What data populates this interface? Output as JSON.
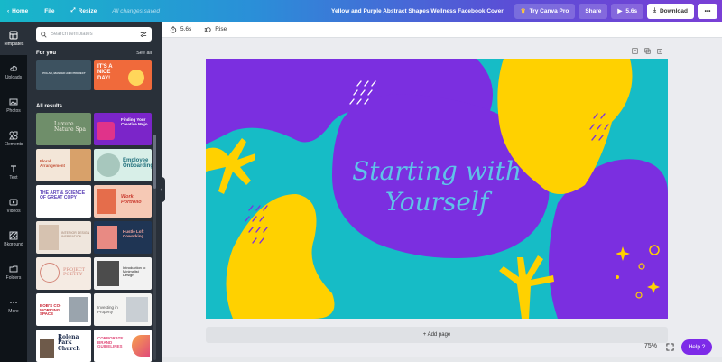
{
  "topbar": {
    "home_label": "Home",
    "file_label": "File",
    "resize_label": "Resize",
    "saved_status": "All changes saved",
    "doc_title": "Yellow and Purple Abstract Shapes Wellness Facebook Cover",
    "pro_label": "Try Canva Pro",
    "share_label": "Share",
    "duration_label": "5.6s",
    "download_label": "Download",
    "more_label": "•••"
  },
  "rail": {
    "items": [
      {
        "label": "Templates",
        "icon": "templates-icon"
      },
      {
        "label": "Uploads",
        "icon": "upload-icon"
      },
      {
        "label": "Photos",
        "icon": "photo-icon"
      },
      {
        "label": "Elements",
        "icon": "elements-icon"
      },
      {
        "label": "Text",
        "icon": "text-icon"
      },
      {
        "label": "Videos",
        "icon": "video-icon"
      },
      {
        "label": "Bkground",
        "icon": "background-icon"
      },
      {
        "label": "Folders",
        "icon": "folder-icon"
      },
      {
        "label": "More",
        "icon": "more-icon"
      }
    ]
  },
  "panel": {
    "search_placeholder": "Search templates",
    "for_you_label": "For you",
    "see_all_label": "See all",
    "all_results_label": "All results",
    "featured": [
      {
        "text": "POLAR, MASKED AND PROJECT",
        "bg": "#3d5260",
        "fg": "#dfe6ea"
      },
      {
        "text": "IT'S A NICE DAY!",
        "bg": "#f06a3b",
        "fg": "#ffffff"
      }
    ],
    "templates": [
      {
        "text": "Luxure Nature Spa",
        "bg": "#6f8e6a",
        "fg": "#f3efe4"
      },
      {
        "text": "Finding Your Creative Mojo",
        "bg": "#7b25c9",
        "fg": "#ffffff"
      },
      {
        "text": "Floral Arrangement",
        "bg": "#f3e6d8",
        "fg": "#c4543a"
      },
      {
        "text": "Employee Onboarding",
        "bg": "#d8efe8",
        "fg": "#1e6f7b"
      },
      {
        "text": "THE ART & SCIENCE OF GREAT COPY",
        "bg": "#ffffff",
        "fg": "#5a3fb6"
      },
      {
        "text": "Work Portfolio",
        "bg": "#f6c9b5",
        "fg": "#c93a2e"
      },
      {
        "text": "INTERIOR DESIGN INSPIRATION",
        "bg": "#efe6dd",
        "fg": "#9a7a66"
      },
      {
        "text": "Hustle Loft Coworking",
        "bg": "#1f3554",
        "fg": "#f4a7a0"
      },
      {
        "text": "PROJECT POETRY",
        "bg": "#f5ebe3",
        "fg": "#d4877a"
      },
      {
        "text": "Introduction to Minimalist Design",
        "bg": "#f2f2f2",
        "fg": "#222222"
      },
      {
        "text": "BOB'S CO-WORKING SPACE",
        "bg": "#ffffff",
        "fg": "#c8202f"
      },
      {
        "text": "Investing in Property",
        "bg": "#f4f4f2",
        "fg": "#555555"
      },
      {
        "text": "Rolena Park Church",
        "bg": "#ffffff",
        "fg": "#1b2a4a"
      },
      {
        "text": "CORPORATE BRAND GUIDELINES",
        "bg": "#ffffff",
        "fg": "#e04b7a"
      }
    ]
  },
  "editor": {
    "duration_label": "5.6s",
    "animation_label": "Rise",
    "canvas_title_line1": "Starting with",
    "canvas_title_line2": "Yourself",
    "add_page_label": "+ Add page",
    "zoom_label": "75%",
    "help_label": "Help ?"
  },
  "colors": {
    "teal": "#16bcc6",
    "purple": "#7b2fe0",
    "yellow": "#ffd100",
    "accent": "#7d2ae8"
  }
}
